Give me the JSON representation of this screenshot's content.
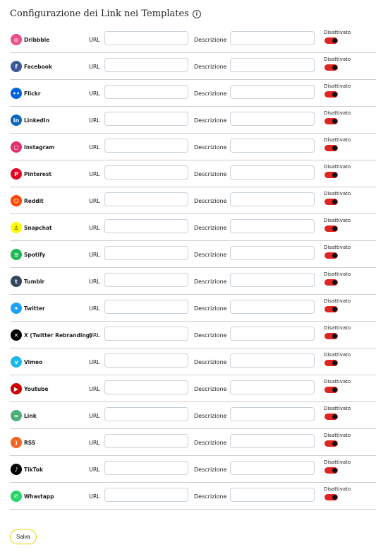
{
  "title": "Configurazione dei Link nei Templates",
  "labels": {
    "url": "URL",
    "description": "Descrizione",
    "status": "Disattivato"
  },
  "save_label": "Salva",
  "items": [
    {
      "name": "Dribbble",
      "icon": "dribbble-icon",
      "glyph": "◎",
      "color": "#ea4c89"
    },
    {
      "name": "Facebook",
      "icon": "facebook-icon",
      "glyph": "f",
      "color": "#3b5998"
    },
    {
      "name": "Flickr",
      "icon": "flickr-icon",
      "glyph": "••",
      "color": "#0063dc"
    },
    {
      "name": "LinkedIn",
      "icon": "linkedin-icon",
      "glyph": "in",
      "color": "#0a66c2"
    },
    {
      "name": "Instagram",
      "icon": "instagram-icon",
      "glyph": "◻",
      "color": "#e1306c"
    },
    {
      "name": "Pinterest",
      "icon": "pinterest-icon",
      "glyph": "P",
      "color": "#e60023"
    },
    {
      "name": "Reddit",
      "icon": "reddit-icon",
      "glyph": "☺",
      "color": "#ff4500"
    },
    {
      "name": "Snapchat",
      "icon": "snapchat-icon",
      "glyph": "♙",
      "color": "#fffc00"
    },
    {
      "name": "Spotify",
      "icon": "spotify-icon",
      "glyph": "≋",
      "color": "#1db954"
    },
    {
      "name": "Tumblr",
      "icon": "tumblr-icon",
      "glyph": "t",
      "color": "#35465c"
    },
    {
      "name": "Twitter",
      "icon": "twitter-icon",
      "glyph": "✦",
      "color": "#1da1f2"
    },
    {
      "name": "X (Twitter Rebranding)",
      "icon": "x-icon",
      "glyph": "✕",
      "color": "#000000"
    },
    {
      "name": "Vimeo",
      "icon": "vimeo-icon",
      "glyph": "v",
      "color": "#1ab7ea"
    },
    {
      "name": "Youtube",
      "icon": "youtube-icon",
      "glyph": "▶",
      "color": "#cc0000"
    },
    {
      "name": "Link",
      "icon": "link-icon",
      "glyph": "∞",
      "color": "#4caf7a"
    },
    {
      "name": "RSS",
      "icon": "rss-icon",
      "glyph": ")",
      "color": "#f26522"
    },
    {
      "name": "TikTok",
      "icon": "tiktok-icon",
      "glyph": "♪",
      "color": "#000000"
    },
    {
      "name": "Whastapp",
      "icon": "whatsapp-icon",
      "glyph": "✆",
      "color": "#25d366"
    }
  ]
}
